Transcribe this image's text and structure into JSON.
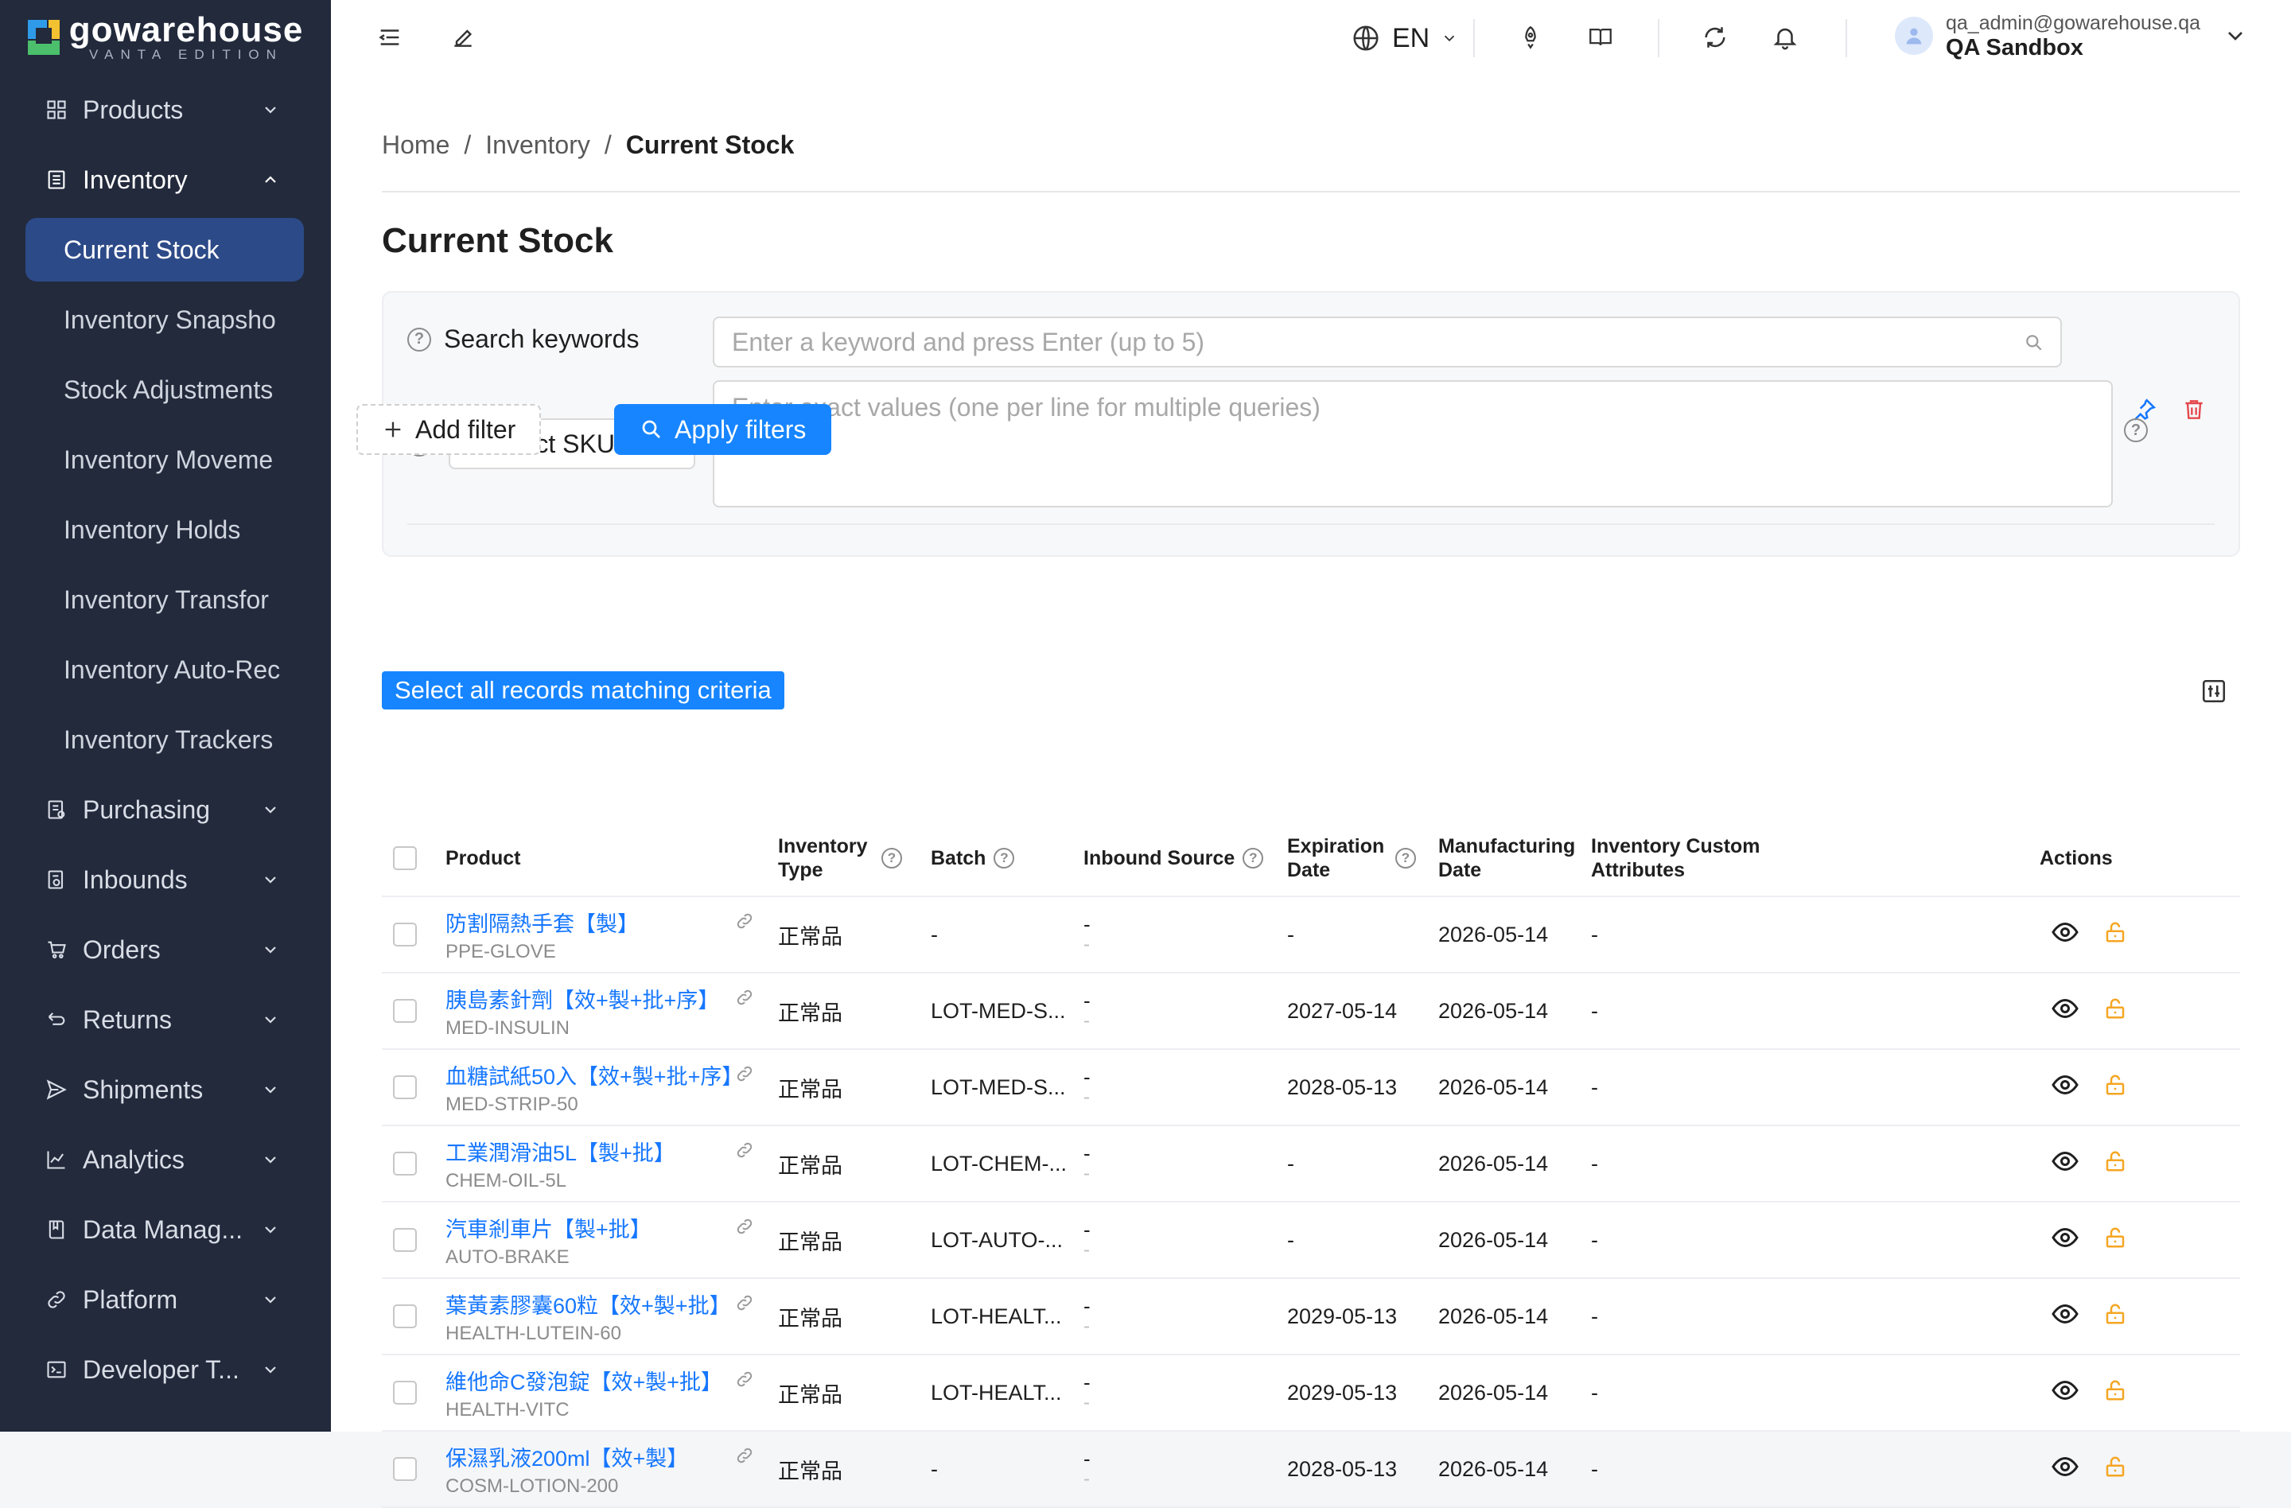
{
  "brand": {
    "name": "gowarehouse",
    "edition": "VANTA EDITION"
  },
  "sidebar": {
    "groups": [
      {
        "label": "Products",
        "icon": "grid-icon",
        "open": false
      },
      {
        "label": "Inventory",
        "icon": "inventory-icon",
        "open": true,
        "items": [
          "Current Stock",
          "Inventory Snapsho",
          "Stock Adjustments",
          "Inventory Moveme",
          "Inventory Holds",
          "Inventory Transfor",
          "Inventory Auto-Rec",
          "Inventory Trackers"
        ],
        "active_item": "Current Stock"
      },
      {
        "label": "Purchasing",
        "icon": "purchasing-icon",
        "open": false
      },
      {
        "label": "Inbounds",
        "icon": "inbound-icon",
        "open": false
      },
      {
        "label": "Orders",
        "icon": "cart-icon",
        "open": false
      },
      {
        "label": "Returns",
        "icon": "return-icon",
        "open": false
      },
      {
        "label": "Shipments",
        "icon": "send-icon",
        "open": false
      },
      {
        "label": "Analytics",
        "icon": "chart-icon",
        "open": false
      },
      {
        "label": "Data Manag...",
        "icon": "book-icon",
        "open": false
      },
      {
        "label": "Platform",
        "icon": "link-icon",
        "open": false
      },
      {
        "label": "Developer T...",
        "icon": "terminal-icon",
        "open": false
      }
    ]
  },
  "header": {
    "language": "EN",
    "user_email": "qa_admin@gowarehouse.qa",
    "user_org": "QA Sandbox"
  },
  "breadcrumb": {
    "home": "Home",
    "section": "Inventory",
    "current": "Current Stock",
    "sep": "/"
  },
  "page_title": "Current Stock",
  "filters": {
    "keyword_label": "Search keywords",
    "keyword_placeholder": "Enter a keyword and press Enter (up to 5)",
    "field_select": "Product SKU",
    "values_placeholder": "Enter exact values (one per line for multiple queries)",
    "add_filter": "Add filter",
    "apply": "Apply filters"
  },
  "select_all_label": "Select all records matching criteria",
  "table": {
    "headers": {
      "product": "Product",
      "inv_type": "Inventory Type",
      "batch": "Batch",
      "inbound_source": "Inbound Source",
      "expiration": "Expiration Date",
      "manufacturing": "Manufacturing Date",
      "custom_attrs": "Inventory Custom Attributes",
      "actions": "Actions"
    },
    "rows": [
      {
        "name": "防割隔熱手套【製】",
        "sku": "PPE-GLOVE",
        "type": "正常品",
        "batch": "-",
        "src_a": "-",
        "src_b": "-",
        "exp": "-",
        "mfg": "2026-05-14",
        "attrs": "-"
      },
      {
        "name": "胰島素針劑【效+製+批+序】",
        "sku": "MED-INSULIN",
        "type": "正常品",
        "batch": "LOT-MED-S...",
        "src_a": "-",
        "src_b": "-",
        "exp": "2027-05-14",
        "mfg": "2026-05-14",
        "attrs": "-"
      },
      {
        "name": "血糖試紙50入【效+製+批+序】",
        "sku": "MED-STRIP-50",
        "type": "正常品",
        "batch": "LOT-MED-S...",
        "src_a": "-",
        "src_b": "-",
        "exp": "2028-05-13",
        "mfg": "2026-05-14",
        "attrs": "-"
      },
      {
        "name": "工業潤滑油5L【製+批】",
        "sku": "CHEM-OIL-5L",
        "type": "正常品",
        "batch": "LOT-CHEM-...",
        "src_a": "-",
        "src_b": "-",
        "exp": "-",
        "mfg": "2026-05-14",
        "attrs": "-"
      },
      {
        "name": "汽車剎車片【製+批】",
        "sku": "AUTO-BRAKE",
        "type": "正常品",
        "batch": "LOT-AUTO-...",
        "src_a": "-",
        "src_b": "-",
        "exp": "-",
        "mfg": "2026-05-14",
        "attrs": "-"
      },
      {
        "name": "葉黃素膠囊60粒【效+製+批】",
        "sku": "HEALTH-LUTEIN-60",
        "type": "正常品",
        "batch": "LOT-HEALT...",
        "src_a": "-",
        "src_b": "-",
        "exp": "2029-05-13",
        "mfg": "2026-05-14",
        "attrs": "-"
      },
      {
        "name": "維他命C發泡錠【效+製+批】",
        "sku": "HEALTH-VITC",
        "type": "正常品",
        "batch": "LOT-HEALT...",
        "src_a": "-",
        "src_b": "-",
        "exp": "2029-05-13",
        "mfg": "2026-05-14",
        "attrs": "-"
      },
      {
        "name": "保濕乳液200ml【效+製】",
        "sku": "COSM-LOTION-200",
        "type": "正常品",
        "batch": "-",
        "src_a": "-",
        "src_b": "-",
        "exp": "2028-05-13",
        "mfg": "2026-05-14",
        "attrs": "-"
      }
    ]
  },
  "colors": {
    "sidebar_bg": "#222a3c",
    "active_item": "#2d4a88",
    "primary": "#1685ff",
    "link": "#1677ff",
    "lock": "#f5a623",
    "danger": "#e5484d"
  }
}
